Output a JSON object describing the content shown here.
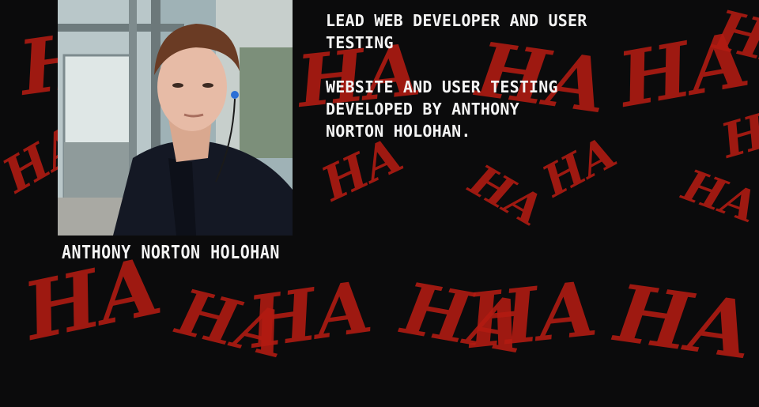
{
  "background": {
    "pattern_text": "HA",
    "pattern_color": "#b31b12",
    "base_color": "#0b0b0c"
  },
  "profile": {
    "photo_alt": "Anthony Norton Holohan",
    "name": "ANTHONY NORTON HOLOHAN"
  },
  "info": {
    "role": "LEAD WEB DEVELOPER AND USER\nTESTING",
    "description": "WEBSITE AND USER TESTING\nDEVELOPED BY ANTHONY\nNORTON HOLOHAN."
  }
}
